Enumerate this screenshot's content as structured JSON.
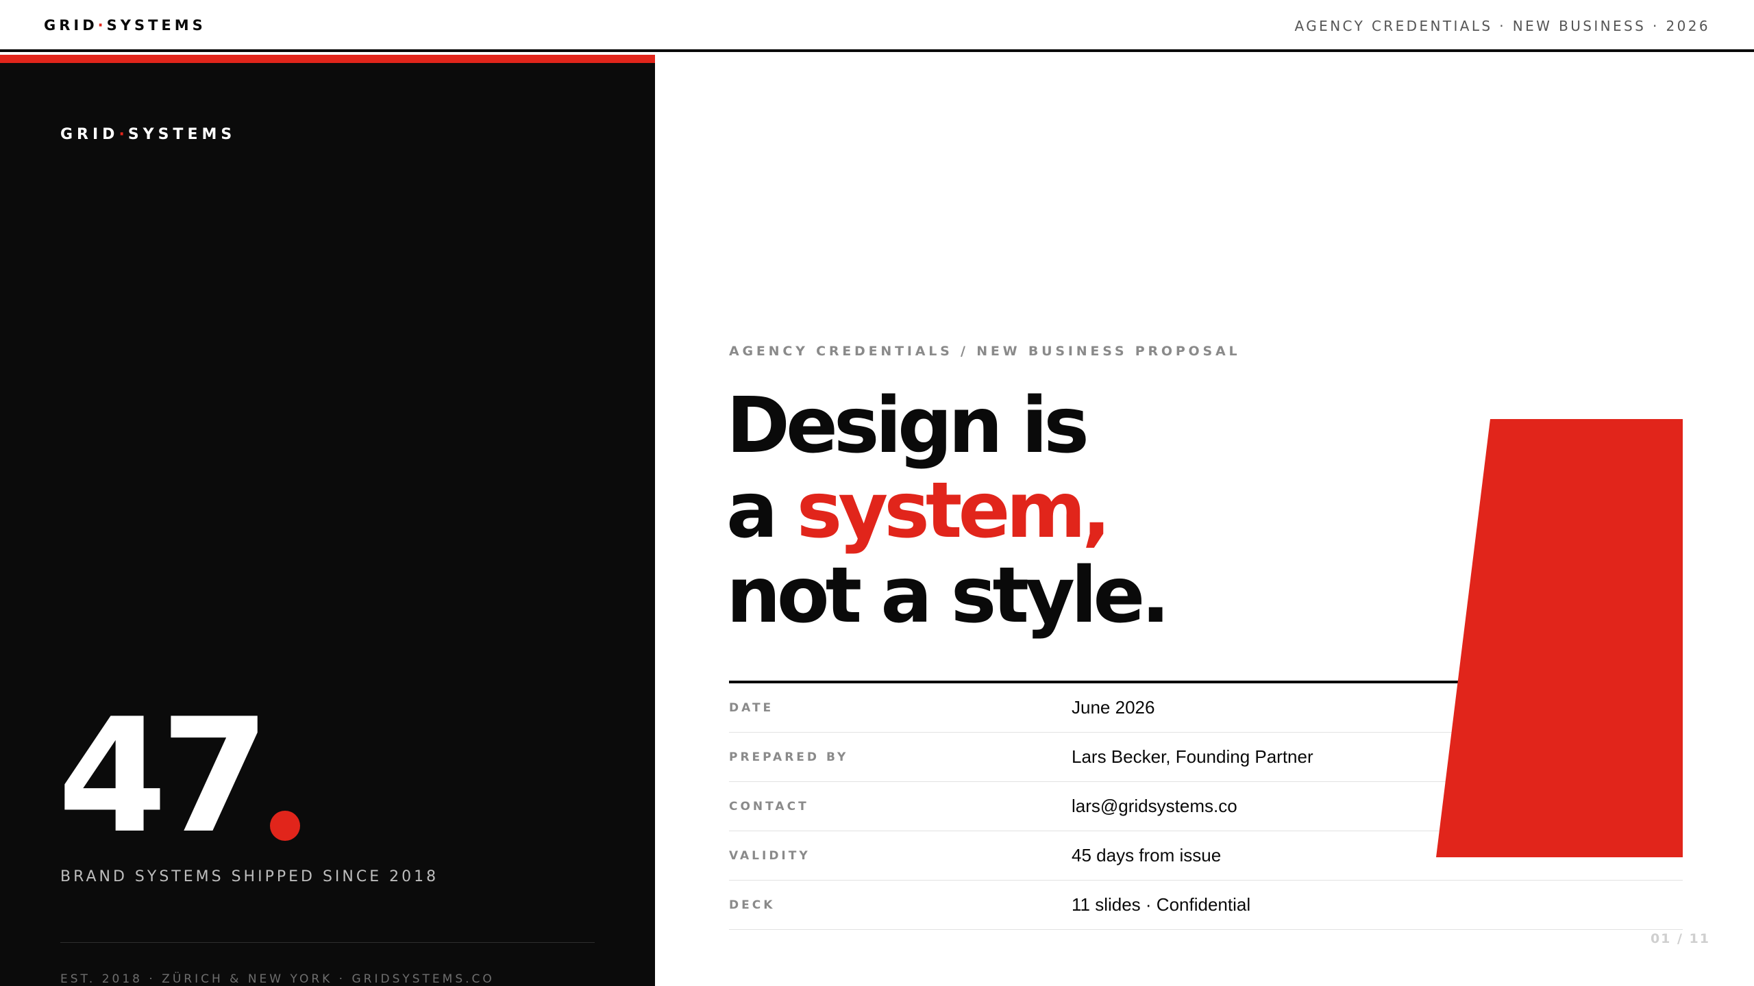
{
  "header": {
    "logo_part1": "GRID",
    "logo_separator": "·",
    "logo_part2": "SYSTEMS",
    "meta": "AGENCY CREDENTIALS · NEW BUSINESS · 2026"
  },
  "left_panel": {
    "logo_part1": "GRID",
    "logo_separator": "·",
    "logo_part2": "SYSTEMS",
    "stat_value": "47",
    "stat_caption": "BRAND SYSTEMS SHIPPED SINCE 2018",
    "footer": "EST. 2018 · ZÜRICH & NEW YORK · GRIDSYSTEMS.CO"
  },
  "main": {
    "eyebrow": "AGENCY CREDENTIALS / NEW BUSINESS PROPOSAL",
    "headline": {
      "line1": "Design is",
      "line2_prefix": "a ",
      "line2_accent": "system,",
      "line3": "not a style."
    },
    "details": [
      {
        "label": "DATE",
        "value": "June 2026"
      },
      {
        "label": "PREPARED BY",
        "value": "Lars Becker, Founding Partner"
      },
      {
        "label": "CONTACT",
        "value": "lars@gridsystems.co"
      },
      {
        "label": "VALIDITY",
        "value": "45 days from issue"
      },
      {
        "label": "DECK",
        "value": "11 slides · Confidential"
      }
    ],
    "page_indicator": "01 / 11"
  },
  "colors": {
    "accent": "#e1251b",
    "dark_panel": "#0b0b0b",
    "text_primary": "#0a0a0a",
    "text_muted": "#8a8a8a"
  }
}
